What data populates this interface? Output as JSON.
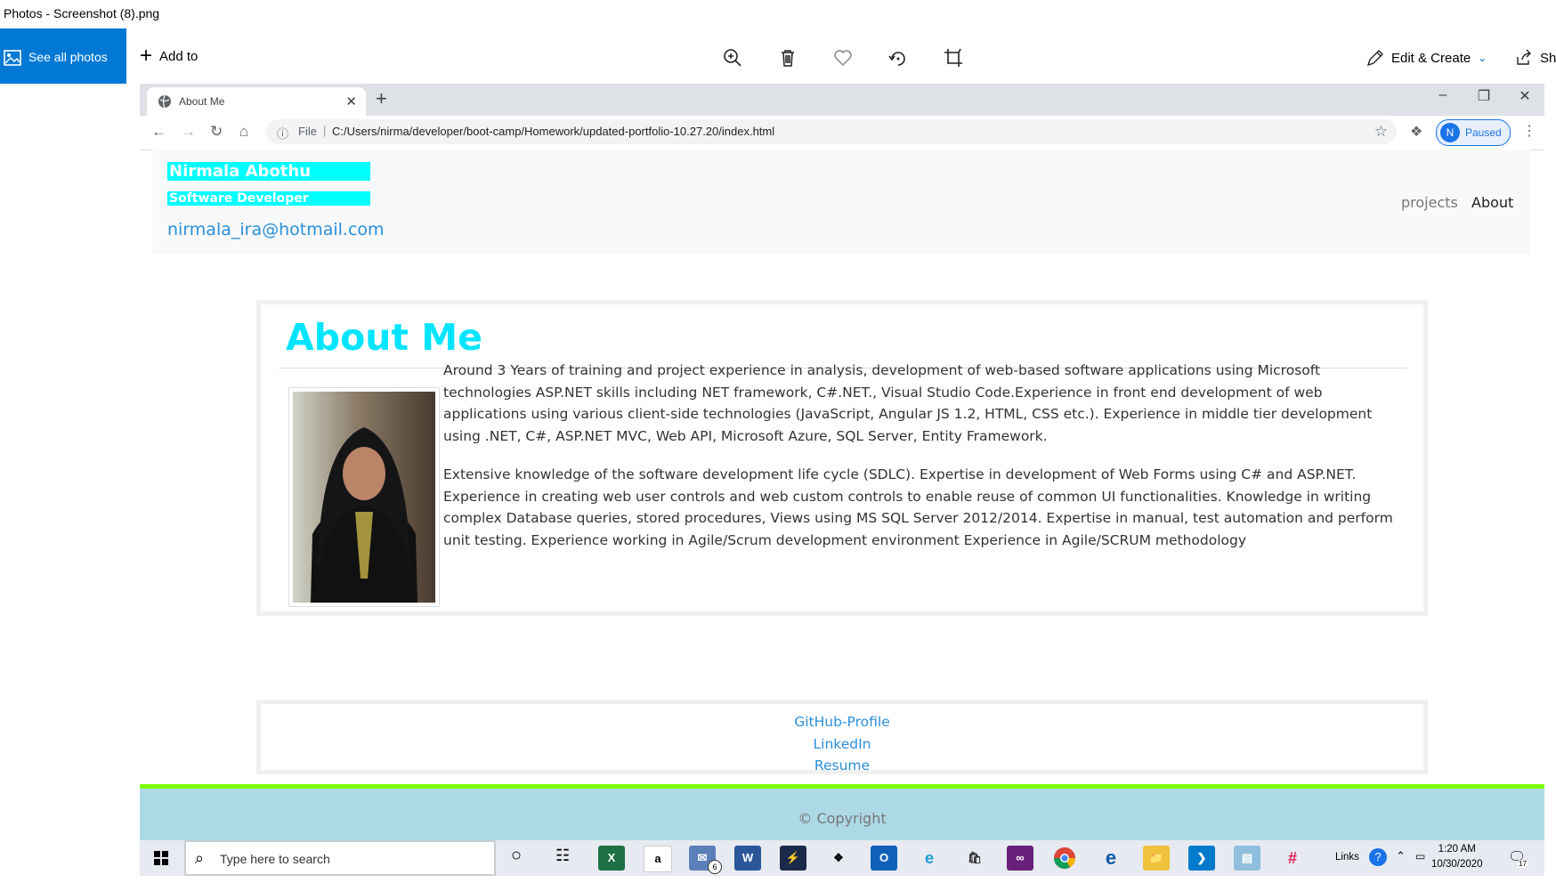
{
  "photos": {
    "title": "Photos - Screenshot (8).png",
    "see_all": "See all photos",
    "add_to": "Add to",
    "edit_create": "Edit & Create",
    "share_partial": "Sh"
  },
  "browser": {
    "tab_title": "About Me",
    "file_label": "File",
    "url": "C:/Users/nirma/developer/boot-camp/Homework/updated-portfolio-10.27.20/index.html",
    "profile_initial": "N",
    "profile_status": "Paused"
  },
  "site": {
    "name": "Nirmala Abothu",
    "role": "Software Developer",
    "email": "nirmala_ira@hotmail.com",
    "nav": {
      "projects": "projects",
      "about": "About"
    },
    "about_title": "About Me",
    "paragraph1": "Around 3 Years of training and project experience in analysis, development of web-based software applications using Microsoft technologies ASP.NET skills including NET framework, C#.NET., Visual Studio Code.Experience in front end development of web applications using various client-side technologies (JavaScript, Angular JS 1.2, HTML, CSS etc.). Experience in middle tier development using .NET, C#, ASP.NET MVC, Web API, Microsoft Azure, SQL Server, Entity Framework.",
    "paragraph2": "Extensive knowledge of the software development life cycle (SDLC). Expertise in development of Web Forms using C# and ASP.NET. Experience in creating web user controls and web custom controls to enable reuse of common UI functionalities. Knowledge in writing complex Database queries, stored procedures, Views using MS SQL Server 2012/2014. Expertise in manual, test automation and perform unit testing. Experience working in Agile/Scrum development environment Experience in Agile/SCRUM methodology",
    "links": {
      "github": "GitHub-Profile",
      "linkedin": "LinkedIn",
      "resume": "Resume"
    },
    "copyright": "© Copyright"
  },
  "taskbar": {
    "search_placeholder": "Type here to search",
    "mail_badge": "6",
    "links_label": "Links",
    "time": "1:20 AM",
    "date": "10/30/2020",
    "notification_count": "17"
  },
  "colors": {
    "accent_blue": "#0078d4",
    "site_cyan": "#00ffff",
    "footer_bg": "#add8e6",
    "footer_border": "#7cfc00"
  }
}
